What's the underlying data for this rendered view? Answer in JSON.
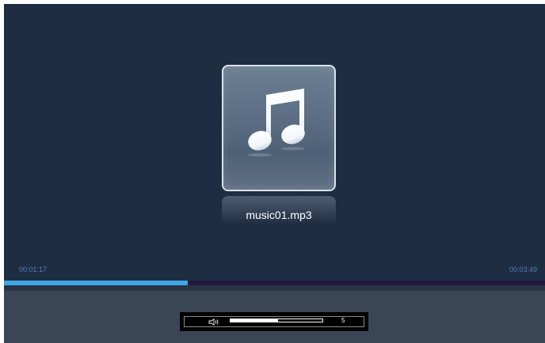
{
  "player": {
    "track_name": "music01.mp3",
    "art_icon": "music-note-icon",
    "time_elapsed": "00:01:17",
    "time_total": "00:03:49",
    "progress_fraction": 0.339,
    "volume_icon": "speaker-icon",
    "volume_level": "5",
    "volume_fraction": 0.52
  },
  "colors": {
    "background": "#1f2d42",
    "progress_fill": "#3fa6e8",
    "progress_track": "#23193d",
    "time_text": "#4e7eb4",
    "bottom_panel": "#3a4656"
  }
}
